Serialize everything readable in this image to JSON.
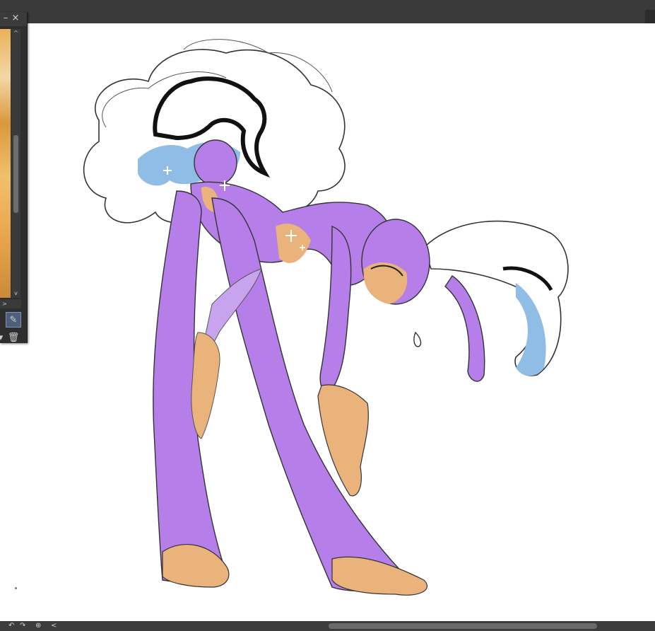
{
  "window": {
    "navigator_panel": {
      "minimize_icon": "minimize-icon",
      "close_label": "×",
      "minimize_label": "–",
      "scroll_up": "^",
      "scroll_down": "v",
      "scroll_right": ">",
      "tools": [
        {
          "name": "eyedropper-icon",
          "glyph": "✎"
        },
        {
          "name": "chevron-down-icon",
          "glyph": "▾"
        },
        {
          "name": "trash-icon",
          "glyph": "🗑"
        }
      ]
    },
    "bottom_bar": {
      "icons": [
        {
          "name": "rotate-left-icon",
          "glyph": "↶"
        },
        {
          "name": "rotate-right-icon",
          "glyph": "↷"
        },
        {
          "name": "reset-view-icon",
          "glyph": "⊕"
        },
        {
          "name": "chevron-left-icon",
          "glyph": "<"
        }
      ]
    }
  },
  "artwork": {
    "subject": "sketch",
    "colors": {
      "body": "#b57ee8",
      "skin": "#eab37c",
      "hair": "#ffffff",
      "shadow": "#8fbde6",
      "line": "#1a1a1a"
    }
  }
}
